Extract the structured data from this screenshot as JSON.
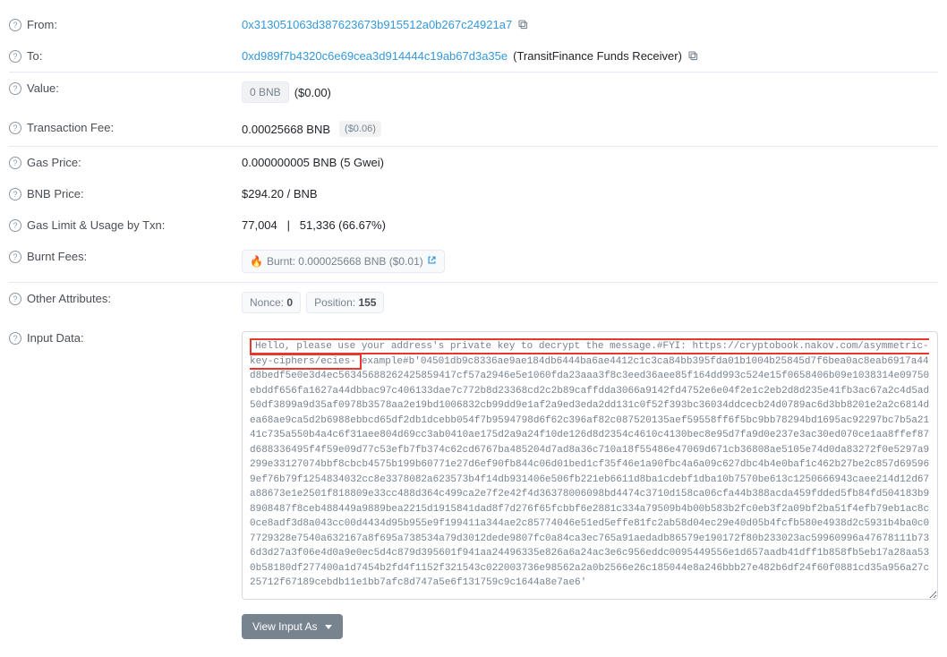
{
  "from": {
    "label": "From:",
    "address": "0x313051063d387623673b915512a0b267c24921a7"
  },
  "to": {
    "label": "To:",
    "address": "0xd989f7b4320c6e69cea3d914444c19ab67d3a35e",
    "name": "(TransitFinance Funds Receiver)"
  },
  "value": {
    "label": "Value:",
    "amount": "0 BNB",
    "usd": "($0.00)"
  },
  "txfee": {
    "label": "Transaction Fee:",
    "amount": "0.00025668 BNB",
    "usd": "($0.06)"
  },
  "gasprice": {
    "label": "Gas Price:",
    "value": "0.000000005 BNB (5 Gwei)"
  },
  "bnbprice": {
    "label": "BNB Price:",
    "value": "$294.20 / BNB"
  },
  "gaslimit": {
    "label": "Gas Limit & Usage by Txn:",
    "value": "77,004   |   51,336 (66.67%)"
  },
  "burnt": {
    "label": "Burnt Fees:",
    "text": "Burnt: 0.000025668 BNB ($0.01)"
  },
  "other": {
    "label": "Other Attributes:",
    "nonce_label": "Nonce:",
    "nonce_value": "0",
    "pos_label": "Position:",
    "pos_value": "155"
  },
  "inputdata": {
    "label": "Input Data:",
    "highlighted": "Hello, please use your address's private key to decrypt the message.#FYI:  https://cryptobook.nakov.com/asymmetric-key-ciphers/ecies-",
    "rest": "example#b'04501db9c8336ae9ae184db6444ba6ae4412c1c3ca84bb395fda01b1004b25845d7f6bea0ac8eab6917a44d8bedf5e0e3d4ec56345688262425859417cf57a2946e5e1060fda23aaa3f8c3eed36aee85f164dd993c524e15f0658406b09e1038314e09750ebddf656fa1627a44dbbac97c406133dae7c772b8d23368cd2c2b89caffdda3066a9142fd4752e6e04f2e1c2eb2d8d235e41fb3ac67a2c4d5ad50df3899a9d35af0978b3578aa2e19bd1006832cb99dd9e1af2a9ed3eda2dd131c0f52f393bc36034ddcecb24d0789ac6d3bb8201e2a2c6814dea68ae9ca5d2b6988ebbcd65df2db1dcebb054f7b9594798d6f62c396af82c087520135aef59558ff6f5bc9bb78294bd1695ac92297bc7b5a2141c735a550b4a4c6f31aee804d69cc3ab0410ae175d2a9a24f10de126d8d2354c4610c4130bec8e95d7fa9d0e237e3ac30ed070ce1aa8ffef87d688336495f4f59e09d77c53efb7fb374c62cd6767ba485204d7ad8a36c710a18f55486e47069d671cb36808ae5105e74d0da83272f0e5297a9299e33127074bbf8cbcb4575b199b60771e27d6ef90fb844c06d01bed1cf35f46e1a90fbc4a6a09c627dbc4b4e0baf1c462b27be2c857d695969ef76b79f1254834032cc8e3378082a623573b4f14db931406e506fb221eb6611d8ba1cdebf1dba10b7570be613c1250666943caee214d12d67a88673e1e2501f818809e33cc488d364c499ca2e7f2e42f4d36378006098bd4474c3710d158ca06cfa44b388acda459fdded5fb84fd504183b98908487f8ceb488449a9889bea2215d1915841dad8f7d276f65fcbbf6e2881c334a79509b4b00b583b2fc0eb3f2a09bf2ba51f4efb79eb1ac8c0ce8adf3d8a043cc00d4434d95b955e9f199411a344ae2c85774046e51ed5effe81fc2ab58d04ec29e40d05b4fcfb580e4938d2c5931b4ba0c07729328e7540a632167a8f695a738534a79d3012dede9807fc0a84ca3ec765a91aedadb86579e190172f80b233023ac59960996a47678111b736d3d27a3f06e4d0a9e0ec5d4c879d395601f941aa24496335e826a6a24ac3e6c956eddc0095449556e1d657aadb41dff1b858fb5eb17a28aa530b58180df277400a1d7454b2fd4f1152f321543c022003736e98562a2a0b2566e26c185044e8a246bbb27e482b6df24f60f0881cd35a956a27c25712f67189cebdb11e1bb7afc8d747a5e6f131759c9c1644a8e7ae6'"
  },
  "buttons": {
    "view_input": "View Input As"
  }
}
